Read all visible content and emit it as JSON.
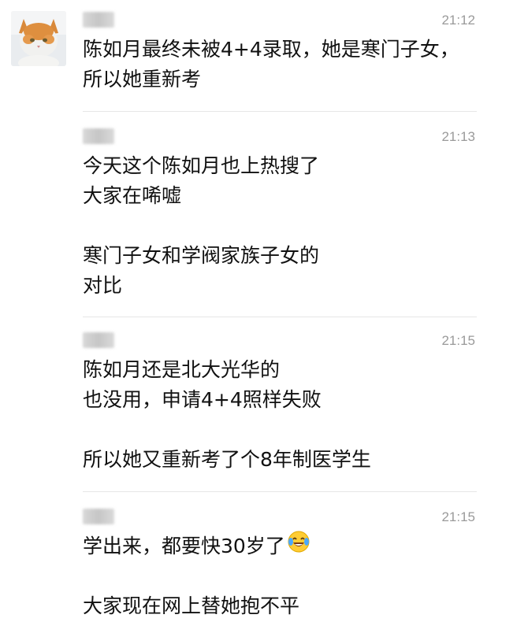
{
  "messages": [
    {
      "time": "21:12",
      "lines": [
        "陈如月最终未被4+4录取，她是寒门子女，",
        "所以她重新考"
      ]
    },
    {
      "time": "21:13",
      "lines": [
        "今天这个陈如月也上热搜了",
        "大家在唏嘘",
        "",
        "寒门子女和学阀家族子女的",
        "对比"
      ]
    },
    {
      "time": "21:15",
      "lines": [
        "陈如月还是北大光华的",
        "也没用，申请4+4照样失败",
        "",
        "所以她又重新考了个8年制医学生"
      ]
    },
    {
      "time": "21:15",
      "lines": [
        "学出来，都要快30岁了",
        "",
        "大家现在网上替她抱不平"
      ],
      "emoji": "crying-laughing-emoji"
    }
  ]
}
